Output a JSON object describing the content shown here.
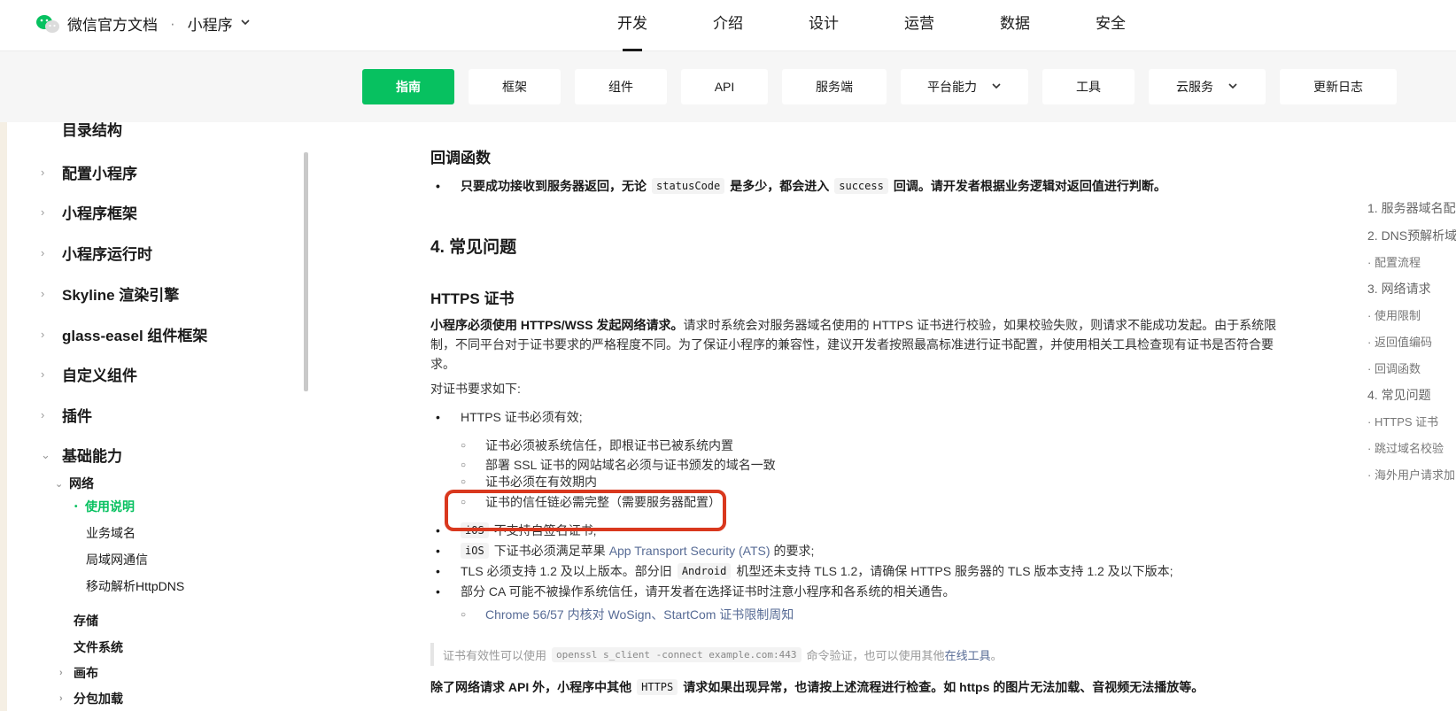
{
  "header": {
    "brand": "微信官方文档",
    "product": "小程序",
    "nav": [
      "开发",
      "介绍",
      "设计",
      "运营",
      "数据",
      "安全"
    ]
  },
  "tabs": [
    "指南",
    "框架",
    "组件",
    "API",
    "服务端",
    "平台能力",
    "工具",
    "云服务",
    "更新日志"
  ],
  "sidebar": {
    "items": [
      "目录结构",
      "配置小程序",
      "小程序框架",
      "小程序运行时",
      "Skyline 渲染引擎",
      "glass-easel 组件框架",
      "自定义组件",
      "插件",
      "基础能力"
    ],
    "network": "网络",
    "network_items": [
      "使用说明",
      "业务域名",
      "局域网通信",
      "移动解析HttpDNS"
    ],
    "more": [
      "存储",
      "文件系统",
      "画布",
      "分包加载"
    ]
  },
  "content": {
    "callback_title": "回调函数",
    "callback_text_a": "只要成功接收到服务器返回，无论",
    "callback_code1": "statusCode",
    "callback_text_b": "是多少，都会进入",
    "callback_code2": "success",
    "callback_text_c": "回调。请开发者根据业务逻辑对返回值进行判断。",
    "section4_title": "4. 常见问题",
    "https_title": "HTTPS 证书",
    "https_para_bold": "小程序必须使用 HTTPS/WSS 发起网络请求。",
    "https_para_line1": "请求时系统会对服务器域名使用的 HTTPS 证书进行校验，如果校验失败，则请求不能成功发起。由于系统限",
    "https_para_line2": "制，不同平台对于证书要求的严格程度不同。为了保证小程序的兼容性，建议开发者按照最高标准进行证书配置，并使用相关工具检查现有证书是否符合要",
    "https_para_line3": "求。",
    "req_intro": "对证书要求如下:",
    "req_valid": "HTTPS 证书必须有效;",
    "req_sub": [
      "证书必须被系统信任，即根证书已被系统内置",
      "部署 SSL 证书的网站域名必须与证书颁发的域名一致",
      "证书必须在有效期内",
      "证书的信任链必需完整（需要服务器配置）"
    ],
    "ios_code": "iOS",
    "ios_selfsign": "不支持自签名证书;",
    "ios_ats_a": "下证书必须满足苹果",
    "ios_ats_link": "App Transport Security (ATS)",
    "ios_ats_b": "的要求;",
    "tls_a": "TLS 必须支持 1.2 及以上版本。部分旧",
    "tls_code": "Android",
    "tls_b": "机型还未支持 TLS 1.2，请确保 HTTPS 服务器的 TLS 版本支持 1.2 及以下版本;",
    "ca_text": "部分 CA 可能不被操作系统信任，请开发者在选择证书时注意小程序和各系统的相关通告。",
    "ca_link": "Chrome 56/57 内核对 WoSign、StartCom 证书限制周知",
    "note_a": "证书有效性可以使用",
    "note_code": "openssl s_client -connect example.com:443",
    "note_b": "命令验证，也可以使用其他",
    "note_link": "在线工具",
    "note_c": "。",
    "last_a": "除了网络请求 API 外，小程序中其他",
    "last_code": "HTTPS",
    "last_b": "请求如果出现异常，也请按上述流程进行检查。如 https 的图片无法加载、音视频无法播放等。"
  },
  "toc": [
    "1. 服务器域名配",
    "2. DNS预解析域",
    "· 配置流程",
    "3. 网络请求",
    "· 使用限制",
    "· 返回值编码",
    "· 回调函数",
    "4. 常见问题",
    "· HTTPS 证书",
    "· 跳过域名校验",
    "· 海外用户请求加"
  ],
  "colors": {
    "accent": "#07c160",
    "highlight_box": "#d9381e",
    "link": "#576b95"
  }
}
